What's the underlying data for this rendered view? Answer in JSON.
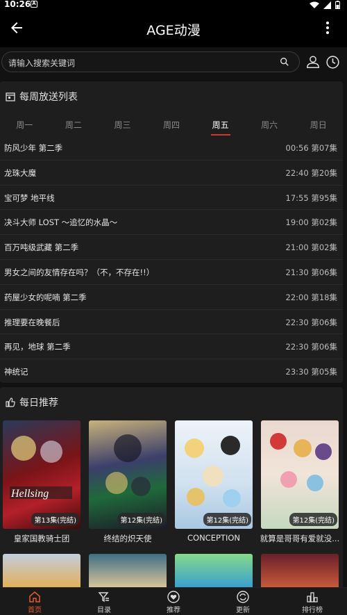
{
  "status": {
    "time": "10:26"
  },
  "appbar": {
    "title": "AGE动漫"
  },
  "search": {
    "placeholder": "请输入搜索关键词"
  },
  "weekly": {
    "title": "每周放送列表",
    "days": [
      "周一",
      "周二",
      "周三",
      "周四",
      "周五",
      "周六",
      "周日"
    ],
    "active_day": "周五",
    "items": [
      {
        "name": "防风少年 第二季",
        "time": "00:56",
        "episode": "第07集"
      },
      {
        "name": "龙珠大魔",
        "time": "22:40",
        "episode": "第20集"
      },
      {
        "name": "宝可梦 地平线",
        "time": "17:55",
        "episode": "第95集"
      },
      {
        "name": "决斗大师 LOST ～追忆的水晶～",
        "time": "19:00",
        "episode": "第02集"
      },
      {
        "name": "百万吨级武藏 第二季",
        "time": "21:00",
        "episode": "第02集"
      },
      {
        "name": "男女之间的友情存在吗？（不，不存在!!）",
        "time": "21:30",
        "episode": "第06集"
      },
      {
        "name": "药屋少女的呢喃 第二季",
        "time": "22:00",
        "episode": "第18集"
      },
      {
        "name": "推理要在晚餐后",
        "time": "22:30",
        "episode": "第06集"
      },
      {
        "name": "再见，地球 第二季",
        "time": "22:30",
        "episode": "第06集"
      },
      {
        "name": "神统记",
        "time": "23:30",
        "episode": "第05集"
      }
    ]
  },
  "daily": {
    "title": "每日推荐",
    "items": [
      {
        "title": "皇家国教骑士团",
        "badge": "第13集(完结)",
        "color": "#7a1418"
      },
      {
        "title": "终结的炽天使",
        "badge": "第12集(完结)",
        "color": "#2b2f4a"
      },
      {
        "title": "CONCEPTION",
        "badge": "第12集(完结)",
        "color": "#d7e6f4"
      },
      {
        "title": "就算是哥哥有爱就没...",
        "badge": "第12集(完结)",
        "color": "#e9d5c9"
      }
    ],
    "next_row_colors": [
      "#b9c7d9",
      "#4f7a8c",
      "#9fd49a",
      "#7a2630"
    ]
  },
  "nav": [
    {
      "label": "首页",
      "icon": "home-icon",
      "active": true
    },
    {
      "label": "目录",
      "icon": "filter-icon",
      "active": false
    },
    {
      "label": "推荐",
      "icon": "heart-icon",
      "active": false
    },
    {
      "label": "更新",
      "icon": "refresh-icon",
      "active": false
    },
    {
      "label": "排行榜",
      "icon": "ranking-icon",
      "active": false
    }
  ],
  "colors": {
    "accent": "#e55a2b",
    "tab_indicator": "#d13a2a",
    "background": "#121212",
    "card": "#1e1e1e"
  }
}
